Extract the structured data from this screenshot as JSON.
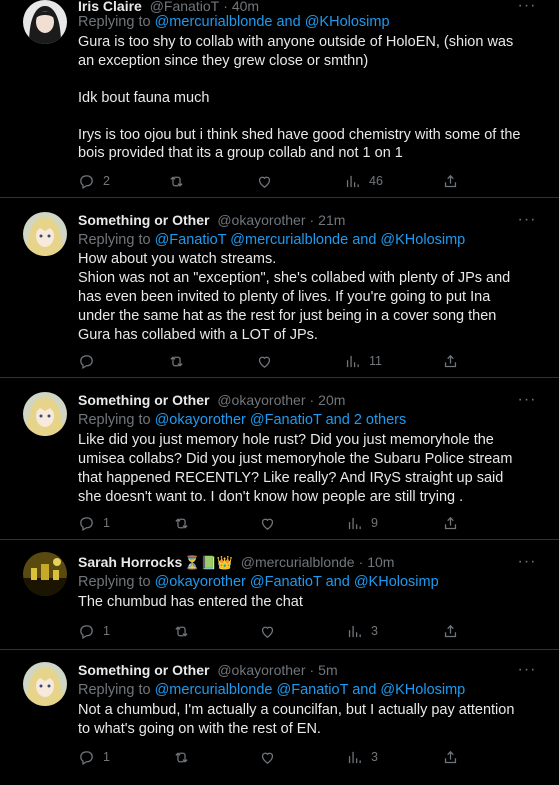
{
  "tweets": [
    {
      "name": "Iris Claire",
      "handle": "@FanatioT",
      "time": "40m",
      "reply_prefix": "Replying to",
      "reply_users": "@mercurialblonde and @KHolosimp",
      "text": "Gura is too shy to collab with anyone outside of HoloEN, (shion was an exception since they grew close or smthn)\n\nIdk bout fauna much\n\nIrys is too ojou but i think shed have good chemistry with some of the bois provided that its a group collab and not 1 on 1",
      "replies": "2",
      "retweets": "",
      "likes": "",
      "views": "46"
    },
    {
      "name": "Something or Other",
      "handle": "@okayorother",
      "time": "21m",
      "reply_prefix": "Replying to",
      "reply_users": "@FanatioT @mercurialblonde and @KHolosimp",
      "text": "How about you watch streams.\nShion was not an \"exception\", she's collabed with plenty of JPs and has even been invited to plenty of lives. If you're going to put Ina under the same hat as the rest for just being in a cover song then Gura has collabed with a LOT of JPs.",
      "replies": "",
      "retweets": "",
      "likes": "",
      "views": "11"
    },
    {
      "name": "Something or Other",
      "handle": "@okayorother",
      "time": "20m",
      "reply_prefix": "Replying to",
      "reply_users": "@okayorother @FanatioT and 2 others",
      "text": "Like did you just memory hole rust? Did you just memoryhole the umisea collabs? Did you just memoryhole the Subaru Police stream that happened RECENTLY? Like really? And IRyS straight up said she doesn't want to. I don't know how people are still trying .",
      "replies": "1",
      "retweets": "",
      "likes": "",
      "views": "9"
    },
    {
      "name": "Sarah Horrocks",
      "name_emojis": "⏳📗👑",
      "handle": "@mercurialblonde",
      "time": "10m",
      "reply_prefix": "Replying to",
      "reply_users": "@okayorother @FanatioT and @KHolosimp",
      "text": "The chumbud has entered the chat",
      "replies": "1",
      "retweets": "",
      "likes": "",
      "views": "3"
    },
    {
      "name": "Something or Other",
      "handle": "@okayorother",
      "time": "5m",
      "reply_prefix": "Replying to",
      "reply_users": "@mercurialblonde @FanatioT and @KHolosimp",
      "text": "Not a chumbud, I'm actually a councilfan, but I actually pay attention to what's going on with the rest of EN.",
      "replies": "1",
      "retweets": "",
      "likes": "",
      "views": "3"
    }
  ],
  "icons": {
    "reply": "reply-icon",
    "retweet": "retweet-icon",
    "like": "like-icon",
    "views": "views-icon",
    "share": "share-icon",
    "more": "more-icon"
  },
  "colors": {
    "background": "#000000",
    "text": "#e7e9ea",
    "muted": "#71767b",
    "link": "#1d9bf0",
    "divider": "#2f3336"
  }
}
